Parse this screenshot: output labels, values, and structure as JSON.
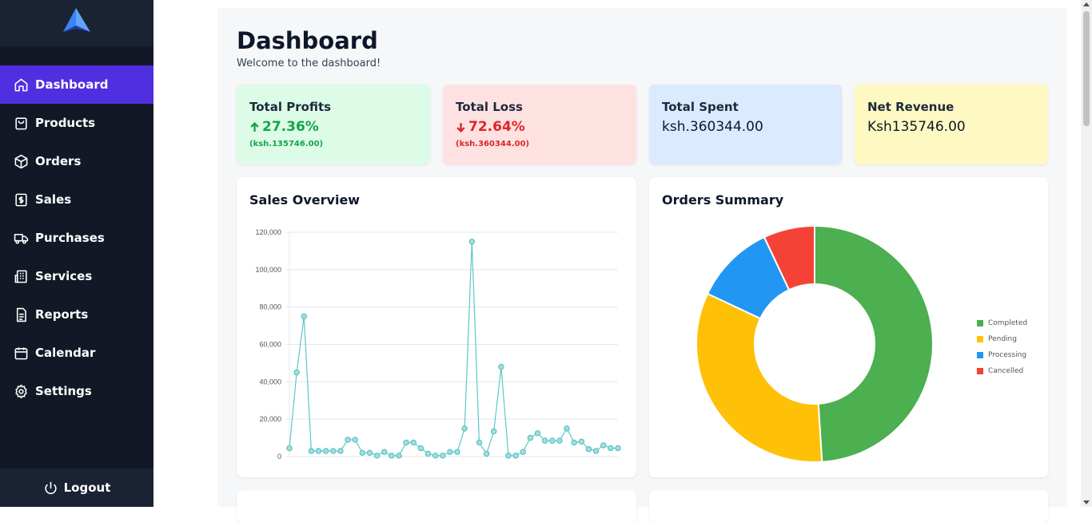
{
  "colors": {
    "sidebar_bg": "#121826",
    "active": "#4f2fe0",
    "profit_green": "#16a34a",
    "loss_red": "#dc2626",
    "line": "#5fc7c7"
  },
  "sidebar": {
    "logo": "logo-icon",
    "items": [
      {
        "label": "Dashboard",
        "icon": "home-icon",
        "active": true
      },
      {
        "label": "Products",
        "icon": "shopping-bag-icon"
      },
      {
        "label": "Orders",
        "icon": "box-icon"
      },
      {
        "label": "Sales",
        "icon": "dollar-icon"
      },
      {
        "label": "Purchases",
        "icon": "truck-icon"
      },
      {
        "label": "Services",
        "icon": "building-icon"
      },
      {
        "label": "Reports",
        "icon": "file-icon"
      },
      {
        "label": "Calendar",
        "icon": "calendar-icon"
      },
      {
        "label": "Settings",
        "icon": "gear-icon"
      }
    ],
    "logout": "Logout"
  },
  "header": {
    "title": "Dashboard",
    "subtitle": "Welcome to the dashboard!"
  },
  "stats": {
    "profits": {
      "title": "Total Profits",
      "value": "27.36%",
      "sub": "(ksh.135746.00)"
    },
    "loss": {
      "title": "Total Loss",
      "value": "72.64%",
      "sub": "(ksh.360344.00)"
    },
    "spent": {
      "title": "Total Spent",
      "value": "ksh.360344.00"
    },
    "revenue": {
      "title": "Net Revenue",
      "value": "Ksh135746.00"
    }
  },
  "sales_overview": {
    "title": "Sales Overview"
  },
  "orders_summary": {
    "title": "Orders Summary"
  },
  "chart_data": [
    {
      "type": "line",
      "ylim": [
        0,
        120000
      ],
      "yticks": [
        "0",
        "20,000",
        "40,000",
        "60,000",
        "80,000",
        "100,000",
        "120,000"
      ],
      "grid": true,
      "values": [
        4500,
        45000,
        75000,
        3000,
        3000,
        3000,
        3000,
        3000,
        9000,
        9000,
        2000,
        2000,
        500,
        2500,
        500,
        500,
        7500,
        7500,
        4500,
        1500,
        500,
        500,
        2500,
        2500,
        15000,
        115000,
        7500,
        1500,
        13500,
        48000,
        500,
        500,
        2500,
        10000,
        12500,
        8500,
        8500,
        8500,
        15000,
        7500,
        8000,
        4000,
        3000,
        6000,
        4500,
        4500
      ]
    },
    {
      "type": "pie",
      "labels": [
        "Completed",
        "Pending",
        "Processing",
        "Cancelled"
      ],
      "values": [
        49,
        33,
        11,
        7
      ],
      "colors": [
        "#4caf50",
        "#ffc107",
        "#2196f3",
        "#f44336"
      ],
      "legend": "right"
    }
  ]
}
